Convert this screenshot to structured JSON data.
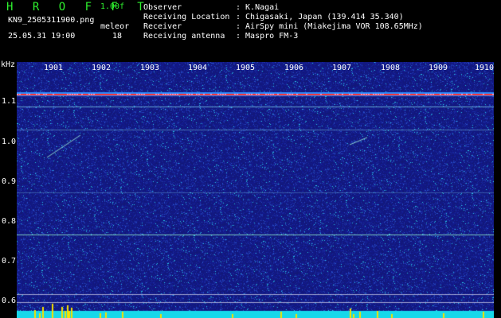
{
  "header": {
    "app_name": "H R O F F T",
    "version": "1.00f",
    "filename": "KN9_2505311900.png",
    "mode": "meleor",
    "count": "18",
    "datetime": "25.05.31 19:00",
    "info": [
      {
        "label": "Observer",
        "value": ": K.Nagai"
      },
      {
        "label": "Receiving Location",
        "value": ": Chigasaki, Japan (139.414 35.340)"
      },
      {
        "label": "Receiver",
        "value": ": AirSpy mini (Miakejima VOR 108.65MHz)"
      },
      {
        "label": "Receiving antenna",
        "value": ": Maspro FM-3"
      }
    ]
  },
  "axis": {
    "y_unit": "kHz",
    "y_ticks": [
      "1.1",
      "1.0",
      "0.9",
      "0.8",
      "0.7",
      "0.6"
    ],
    "x_ticks": [
      "1901",
      "1902",
      "1903",
      "1904",
      "1905",
      "1906",
      "1907",
      "1908",
      "1909",
      "1910"
    ]
  },
  "colors": {
    "background": "#000000",
    "spectrogram_base": "#14197a",
    "carrier_line": "#ff3030",
    "baseline_strip": "#16d8ea",
    "meteor_spikes": "#f5e000",
    "header_green": "#2ef02e"
  }
}
